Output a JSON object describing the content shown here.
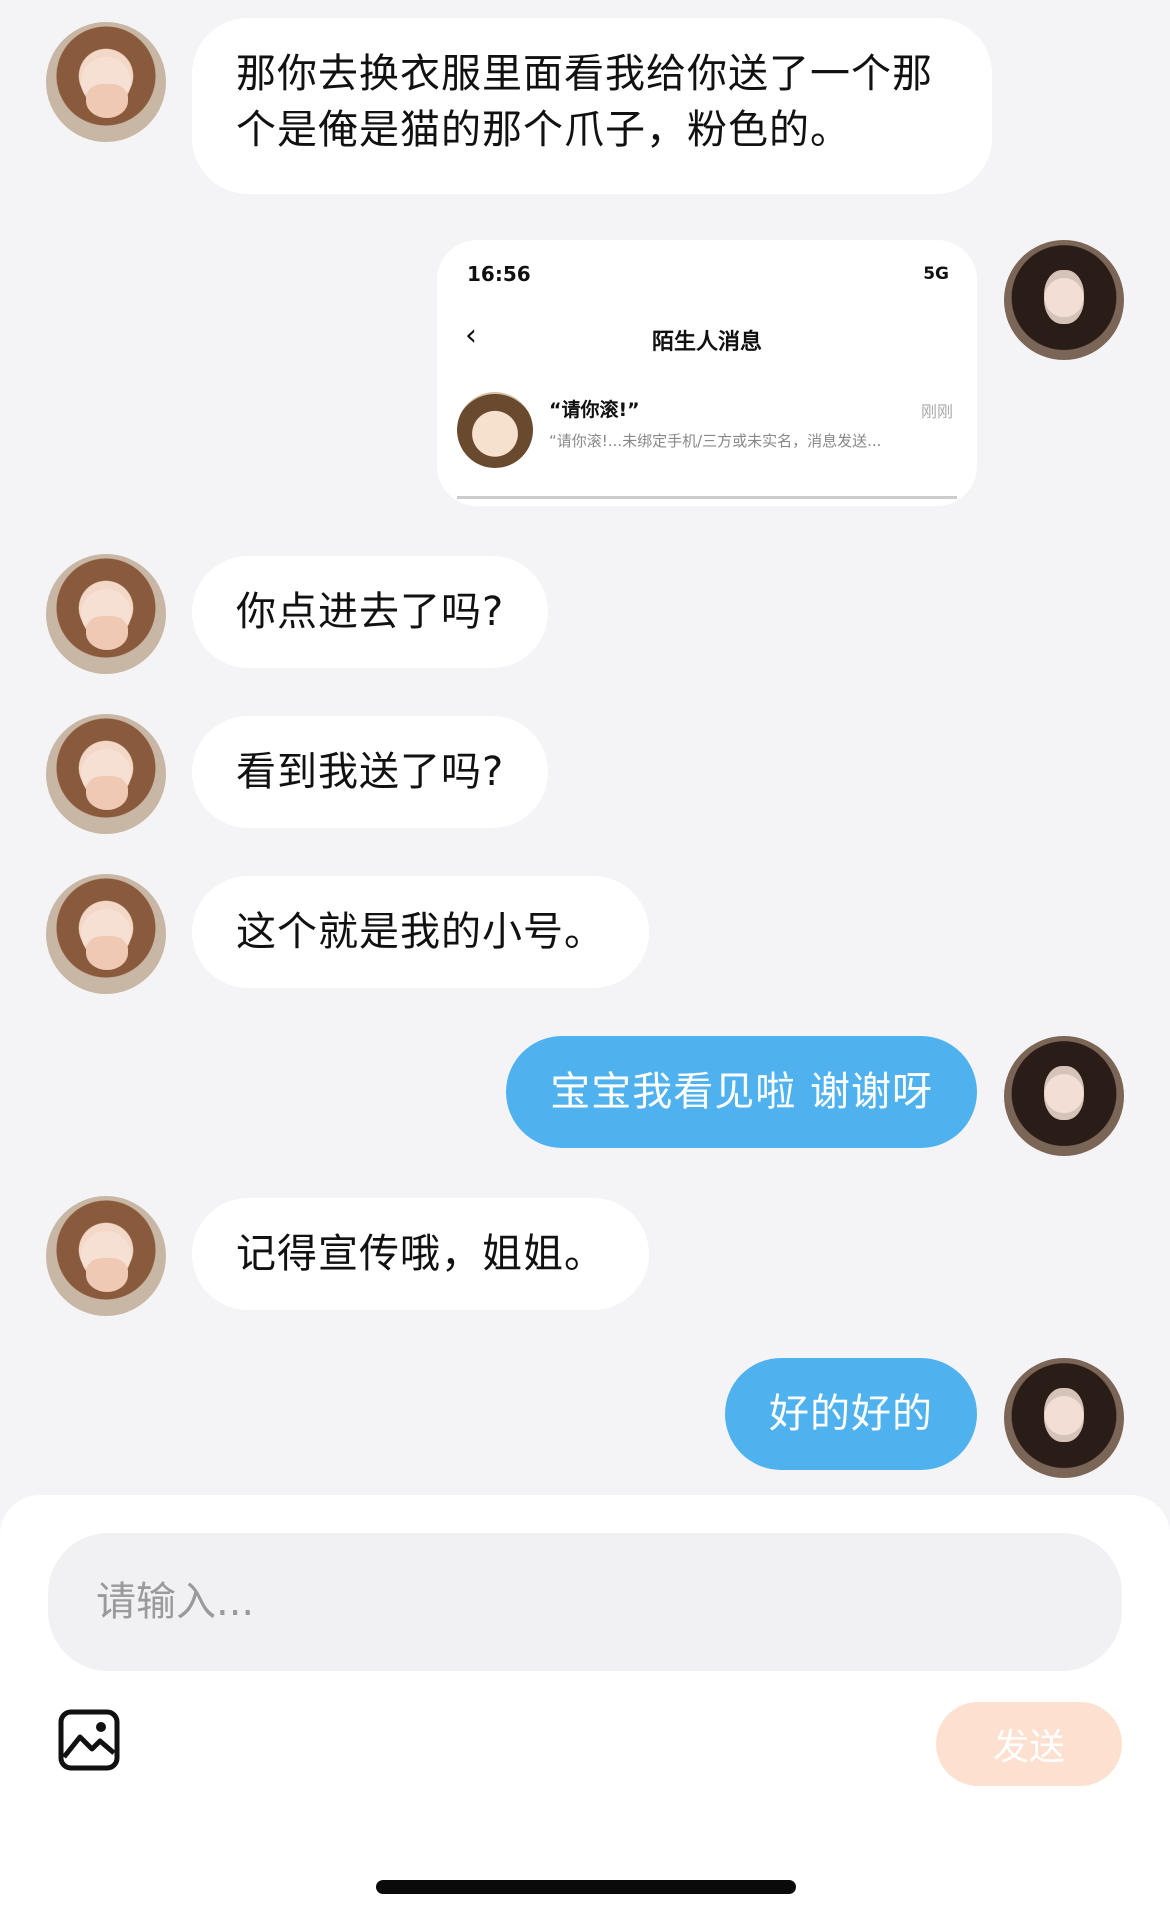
{
  "messages": [
    {
      "side": "them",
      "text": "那你去换衣服里面看我给你送了一个那个是俺是猫的那个爪子，粉色的。"
    },
    {
      "side": "me",
      "type": "screenshot"
    },
    {
      "side": "them",
      "text": "你点进去了吗?"
    },
    {
      "side": "them",
      "text": "看到我送了吗?"
    },
    {
      "side": "them",
      "text": "这个就是我的小号。"
    },
    {
      "side": "me",
      "text": "宝宝我看见啦  谢谢呀"
    },
    {
      "side": "them",
      "text": "记得宣传哦，姐姐。"
    },
    {
      "side": "me",
      "text": "好的好的"
    }
  ],
  "screenshot": {
    "time": "16:56",
    "status": "5G",
    "title": "陌生人消息",
    "contact_name": "“请你滚!”",
    "contact_time": "刚刚",
    "contact_preview": "“请你滚!...未绑定手机/三方或未实名，消息发送..."
  },
  "input": {
    "placeholder": "请输入..."
  },
  "send_label": "发送",
  "colors": {
    "my_bubble": "#4fb2ef",
    "send_button": "#fde0cf"
  }
}
